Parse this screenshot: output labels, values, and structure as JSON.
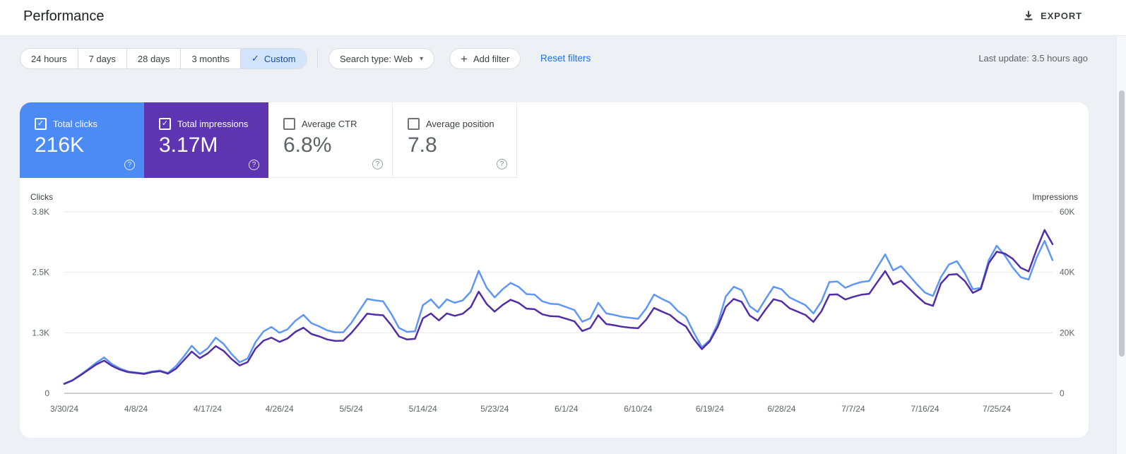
{
  "header": {
    "title": "Performance",
    "export_label": "EXPORT"
  },
  "icons": {
    "check": "✓",
    "caret": "▾",
    "plus": "+",
    "help": "?"
  },
  "filters": {
    "date_ranges": [
      {
        "label": "24 hours",
        "selected": false
      },
      {
        "label": "7 days",
        "selected": false
      },
      {
        "label": "28 days",
        "selected": false
      },
      {
        "label": "3 months",
        "selected": false
      },
      {
        "label": "Custom",
        "selected": true
      }
    ],
    "search_type": "Search type: Web",
    "add_filter": "Add filter",
    "reset_filters": "Reset filters",
    "last_update": "Last update: 3.5 hours ago"
  },
  "metrics": [
    {
      "label": "Total clicks",
      "value": "216K",
      "checked": true,
      "color": "#4c8bf4"
    },
    {
      "label": "Total impressions",
      "value": "3.17M",
      "checked": true,
      "color": "#5e35b1"
    },
    {
      "label": "Average CTR",
      "value": "6.8%",
      "checked": false,
      "color": "#ffffff"
    },
    {
      "label": "Average position",
      "value": "7.8",
      "checked": false,
      "color": "#ffffff"
    }
  ],
  "chart_data": {
    "type": "line",
    "grid": "horizontal",
    "left_axis": {
      "label": "Clicks",
      "ticks": [
        "3.8K",
        "2.5K",
        "1.3K",
        "0"
      ],
      "max": 3750
    },
    "right_axis": {
      "label": "Impressions",
      "ticks": [
        "60K",
        "40K",
        "20K",
        "0"
      ],
      "max": 60000
    },
    "x_ticks": [
      {
        "label": "3/30/24",
        "i": 0
      },
      {
        "label": "4/8/24",
        "i": 9
      },
      {
        "label": "4/17/24",
        "i": 18
      },
      {
        "label": "4/26/24",
        "i": 27
      },
      {
        "label": "5/5/24",
        "i": 36
      },
      {
        "label": "5/14/24",
        "i": 45
      },
      {
        "label": "5/23/24",
        "i": 54
      },
      {
        "label": "6/1/24",
        "i": 63
      },
      {
        "label": "6/10/24",
        "i": 72
      },
      {
        "label": "6/19/24",
        "i": 81
      },
      {
        "label": "6/28/24",
        "i": 90
      },
      {
        "label": "7/7/24",
        "i": 99
      },
      {
        "label": "7/16/24",
        "i": 108
      },
      {
        "label": "7/25/24",
        "i": 117
      }
    ],
    "series": [
      {
        "name": "Clicks",
        "axis": "left",
        "color": "#5e97f6",
        "values": [
          200,
          270,
          380,
          500,
          630,
          740,
          600,
          510,
          450,
          430,
          410,
          450,
          470,
          420,
          560,
          760,
          980,
          810,
          930,
          1150,
          1020,
          810,
          640,
          720,
          1060,
          1280,
          1370,
          1250,
          1320,
          1500,
          1620,
          1450,
          1380,
          1300,
          1260,
          1260,
          1450,
          1700,
          1950,
          1920,
          1900,
          1650,
          1350,
          1270,
          1280,
          1820,
          1940,
          1760,
          1940,
          1870,
          1920,
          2100,
          2530,
          2180,
          1980,
          2150,
          2280,
          2200,
          2050,
          2040,
          1900,
          1850,
          1840,
          1780,
          1720,
          1480,
          1550,
          1870,
          1650,
          1620,
          1580,
          1560,
          1540,
          1750,
          2040,
          1950,
          1870,
          1700,
          1580,
          1250,
          950,
          1100,
          1440,
          2000,
          2200,
          2130,
          1800,
          1680,
          1950,
          2200,
          2150,
          1980,
          1900,
          1820,
          1650,
          1900,
          2300,
          2310,
          2180,
          2250,
          2300,
          2320,
          2600,
          2870,
          2540,
          2630,
          2440,
          2250,
          2080,
          2010,
          2400,
          2660,
          2730,
          2480,
          2150,
          2180,
          2750,
          3050,
          2850,
          2600,
          2400,
          2350,
          2800,
          3150,
          2750
        ]
      },
      {
        "name": "Impressions",
        "axis": "right",
        "color": "#512da8",
        "values": [
          3100,
          4200,
          5900,
          7700,
          9500,
          10800,
          9000,
          7800,
          7000,
          6700,
          6400,
          7000,
          7300,
          6500,
          8100,
          10900,
          13800,
          11600,
          13200,
          15600,
          14000,
          11300,
          9200,
          10300,
          14800,
          17400,
          18400,
          17000,
          18100,
          20300,
          21700,
          19600,
          18800,
          17800,
          17300,
          17400,
          19900,
          23000,
          26300,
          26000,
          25800,
          22600,
          18800,
          17800,
          18000,
          24800,
          26400,
          24100,
          26400,
          25600,
          26300,
          28500,
          33600,
          29500,
          27000,
          29200,
          30900,
          29900,
          28000,
          27800,
          26100,
          25500,
          25400,
          24600,
          23800,
          20600,
          21600,
          25800,
          22900,
          22500,
          22000,
          21700,
          21500,
          24300,
          28200,
          27000,
          25900,
          23700,
          22100,
          17900,
          14600,
          17200,
          22000,
          28600,
          31200,
          30200,
          25700,
          24000,
          27700,
          31100,
          30400,
          28100,
          27000,
          25900,
          23600,
          27100,
          32600,
          32700,
          31000,
          31900,
          32600,
          32900,
          36700,
          40400,
          36000,
          37200,
          34700,
          32100,
          29800,
          28900,
          36300,
          39200,
          39400,
          37100,
          33200,
          34500,
          43000,
          46800,
          46200,
          44500,
          41500,
          40300,
          47500,
          54000,
          49300
        ]
      }
    ]
  }
}
